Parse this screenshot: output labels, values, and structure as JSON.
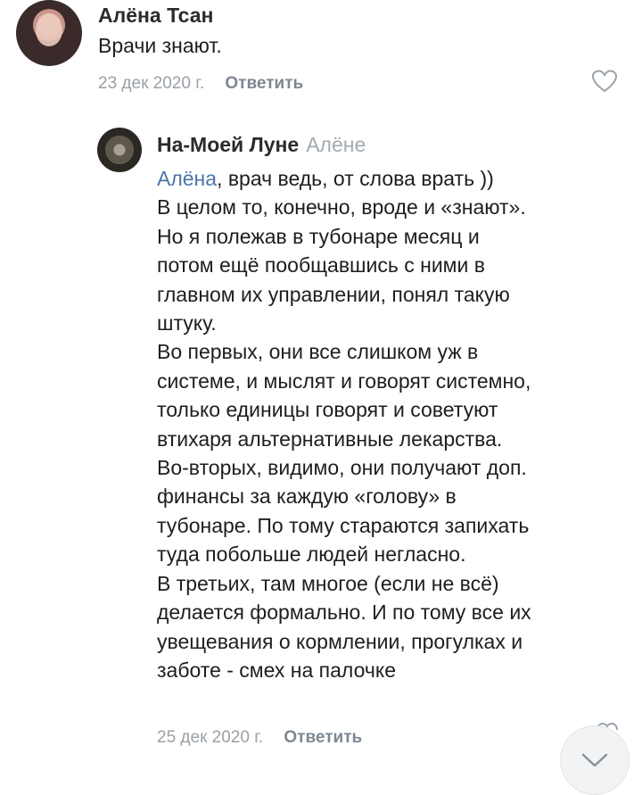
{
  "comment1": {
    "author": "Алёна Тсан",
    "text": "Врачи знают.",
    "date": "23 дек 2020 г.",
    "reply_label": "Ответить"
  },
  "comment2": {
    "author": "На-Моей Луне",
    "reply_to": "Алёне",
    "mention": "Алёна",
    "lines": [
      ", врач ведь, от слова врать ))",
      "В целом то, конечно, вроде и «знают».",
      "Но я полежав в тубонаре месяц и",
      "потом ещё пообщавшись с ними в",
      "главном их управлении, понял такую",
      "штуку.",
      "Во первых, они все слишком уж в",
      "системе, и мыслят и говорят системно,",
      "только единицы говорят и советуют",
      "втихаря альтернативные лекарства.",
      "Во-вторых, видимо, они получают доп.",
      "финансы за каждую «голову» в",
      "тубонаре. По тому стараются запихать",
      "туда побольше людей негласно.",
      "В третьих, там многое (если не всё)",
      "делается формально. И по тому все их",
      "увещевания о кормлении, прогулках и",
      "заботе - смех на палочке"
    ],
    "date": "25 дек 2020 г.",
    "reply_label": "Ответить"
  },
  "icons": {
    "like": "heart-icon",
    "scroll": "chevron-down-icon"
  },
  "colors": {
    "mention": "#4a76a8",
    "meta": "#9aa0a6"
  }
}
